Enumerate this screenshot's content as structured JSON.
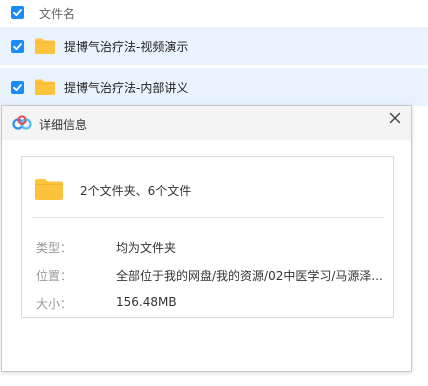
{
  "file_list": {
    "header_label": "文件名",
    "rows": [
      {
        "name": "提博气治疗法-视频演示",
        "checked": true
      },
      {
        "name": "提博气治疗法-内部讲义",
        "checked": true
      }
    ]
  },
  "dialog": {
    "title": "详细信息",
    "close_icon": "close-icon",
    "summary": "2个文件夹、6个文件",
    "fields": {
      "type_label": "类型：",
      "type_value": "均为文件夹",
      "location_label": "位置：",
      "location_value": "全部位于我的网盘/我的资源/02中医学习/马源泽...",
      "size_label": "大小：",
      "size_value": "156.48MB"
    }
  },
  "colors": {
    "accent": "#1a8cf7",
    "row_highlight": "#e8f3fd",
    "folder": "#fcc33c",
    "title_bar": "#f4f4f4"
  }
}
